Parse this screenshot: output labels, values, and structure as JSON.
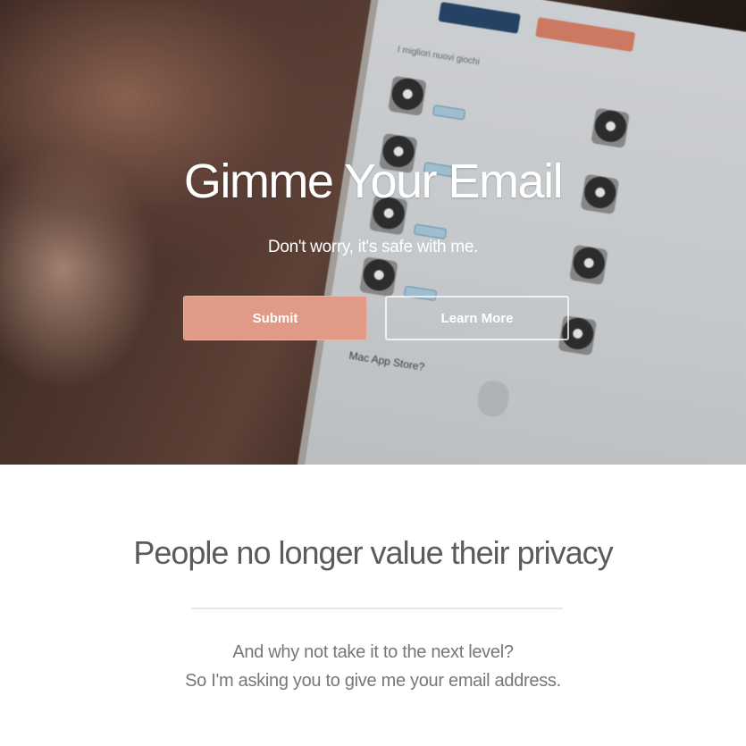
{
  "hero": {
    "title": "Gimme Your Email",
    "subtitle": "Don't worry, it's safe with me.",
    "submit_label": "Submit",
    "learn_more_label": "Learn More",
    "background_screen": {
      "store_section_title": "I migliori nuovi giochi",
      "store_footer_text": "Mac App Store?"
    }
  },
  "section": {
    "heading": "People no longer value their privacy",
    "paragraph_line1": "And why not take it to the next level?",
    "paragraph_line2": "So I'm asking you to give me your email address."
  },
  "colors": {
    "submit_button": "#e09a86",
    "heading_text": "#5b5b5b",
    "body_text": "#777777",
    "divider": "#e6e6e6"
  }
}
